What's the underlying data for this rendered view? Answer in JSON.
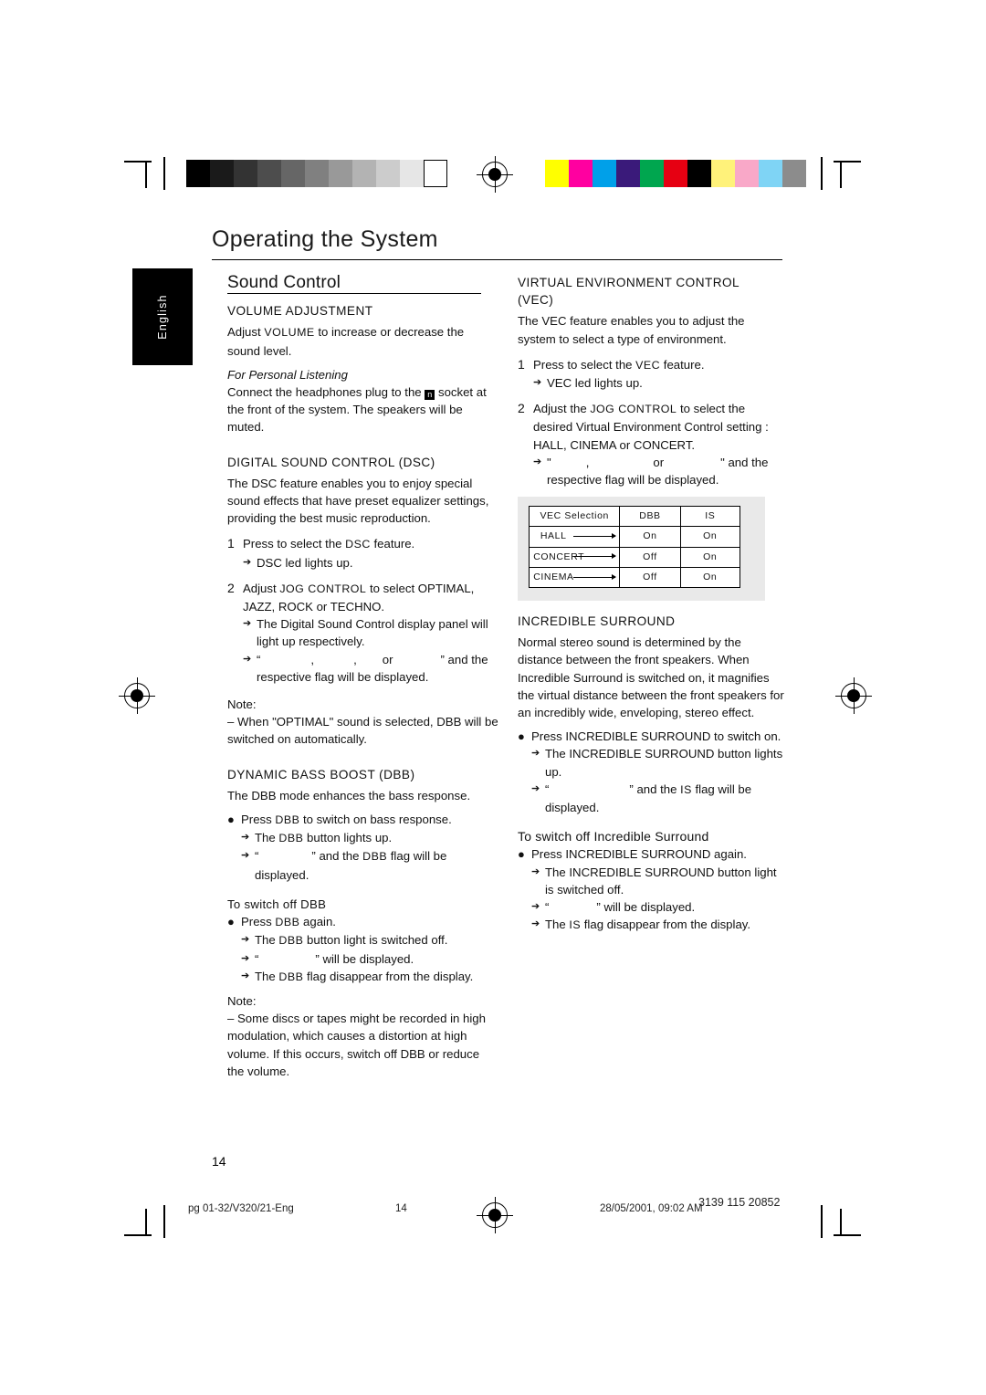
{
  "header": {
    "title": "Operating the System",
    "language_tab": "English"
  },
  "left_column": {
    "section_title": "Sound Control",
    "volume": {
      "heading": "VOLUME ADJUSTMENT",
      "p1_pre": "Adjust ",
      "p1_key": "VOLUME",
      "p1_post": " to increase or decrease the sound level.",
      "personal_heading": "For Personal Listening",
      "p2_pre": "Connect the headphones plug to the ",
      "p2_post": " socket at the front of the system. The speakers will be muted."
    },
    "dsc": {
      "heading": "DIGITAL SOUND CONTROL  (DSC)",
      "intro": "The DSC feature enables you to enjoy special sound effects that have preset equalizer settings, providing the best music reproduction.",
      "step1_num": "1",
      "step1_pre": "Press to select the ",
      "step1_key": "DSC",
      "step1_post": " feature.",
      "step1_arrow": "DSC led lights up.",
      "step2_num": "2",
      "step2_pre": "Adjust ",
      "step2_key": "JOG CONTROL",
      "step2_post": " to select OPTIMAL, JAZZ, ROCK or TECHNO.",
      "step2_arrow1": "The Digital Sound Control display panel will light up respectively.",
      "step2_arrow2_a": "“",
      "step2_arrow2_b": ",",
      "step2_arrow2_c": ",",
      "step2_arrow2_d": "or",
      "step2_arrow2_e": "” and the respective flag will be displayed.",
      "note_label": "Note:",
      "note_text": "–  When \"OPTIMAL\" sound is selected, DBB will be switched on automatically."
    },
    "dbb": {
      "heading": "DYNAMIC BASS BOOST (DBB)",
      "intro": "The DBB mode enhances the bass response.",
      "b1_pre": "Press ",
      "b1_key": "DBB",
      "b1_post": " to switch on bass response.",
      "a1_pre": "The ",
      "a1_key": "DBB",
      "a1_post": " button lights up.",
      "a2_pre": "“",
      "a2_mid": "” and the ",
      "a2_key": "DBB",
      "a2_post": " flag will be displayed.",
      "off_heading": "To switch off DBB",
      "b2_pre": "Press ",
      "b2_key": "DBB",
      "b2_post": " again.",
      "a3_pre": "The ",
      "a3_key": "DBB",
      "a3_post": " button light is switched off.",
      "a4_pre": "“",
      "a4_post": "” will be displayed.",
      "a5_pre": "The ",
      "a5_key": "DBB",
      "a5_post": " flag disappear from the display.",
      "note_label": "Note:",
      "note_text": "–  Some discs or tapes might be recorded in high modulation, which causes a distortion at high volume. If this occurs, switch off DBB or reduce the volume."
    }
  },
  "right_column": {
    "vec": {
      "heading_line1": "VIRTUAL ENVIRONMENT CONTROL",
      "heading_line2": "(VEC)",
      "intro": "The VEC feature enables you to adjust the system to select a type of environment.",
      "step1_num": "1",
      "step1_pre": "Press to select the ",
      "step1_key": "VEC",
      "step1_post": " feature.",
      "step1_arrow": "VEC led lights up.",
      "step2_num": "2",
      "step2_pre": "Adjust the ",
      "step2_key": "JOG CONTROL",
      "step2_post": " to select the desired Virtual Environment Control setting : HALL, CINEMA or CONCERT.",
      "step2_arrow_a": "\"",
      "step2_arrow_b": ",",
      "step2_arrow_c": "or",
      "step2_arrow_d": "\" and the respective flag will be displayed."
    },
    "vec_table": {
      "headers": [
        "VEC Selection",
        "DBB",
        "IS"
      ],
      "rows": [
        {
          "selection": "HALL",
          "dbb": "On",
          "is": "On"
        },
        {
          "selection": "CONCERT",
          "dbb": "Off",
          "is": "On"
        },
        {
          "selection": "CINEMA",
          "dbb": "Off",
          "is": "On"
        }
      ]
    },
    "incredible": {
      "heading": "INCREDIBLE SURROUND",
      "intro": "Normal stereo sound is determined by the distance between the front speakers. When Incredible Surround is switched on, it magnifies the virtual distance between the front speakers for an incredibly wide, enveloping, stereo effect.",
      "b1": "Press INCREDIBLE SURROUND to switch on.",
      "a1": "The INCREDIBLE SURROUND button lights up.",
      "a2_pre": "“",
      "a2_mid": "” and the ",
      "a2_key": "IS",
      "a2_post": " flag will be displayed.",
      "off_heading": "To switch off Incredible Surround",
      "b2": "Press INCREDIBLE SURROUND again.",
      "a3": "The INCREDIBLE SURROUND button light is switched off.",
      "a4_pre": "“",
      "a4_post": "” will be displayed.",
      "a5_pre": "The ",
      "a5_key": "IS",
      "a5_post": " flag disappear from the display."
    }
  },
  "footer": {
    "page_number": "14",
    "file_label": "pg 01-32/V320/21-Eng",
    "center_number": "14",
    "date": "28/05/2001, 09:02 AM",
    "doc_code": "3139 115 20852"
  },
  "print_marks": {
    "gray_bars": [
      "#000000",
      "#1a1a1a",
      "#333333",
      "#4d4d4d",
      "#666666",
      "#808080",
      "#999999",
      "#b3b3b3",
      "#cccccc",
      "#e6e6e6",
      "#ffffff"
    ],
    "color_bars": [
      "#ffff00",
      "#ff00a0",
      "#00a0e9",
      "#3a1a7a",
      "#00a64f",
      "#e60012",
      "#000000",
      "#fff27a",
      "#f9a8c8",
      "#7fd4f5",
      "#8c8c8c"
    ]
  }
}
